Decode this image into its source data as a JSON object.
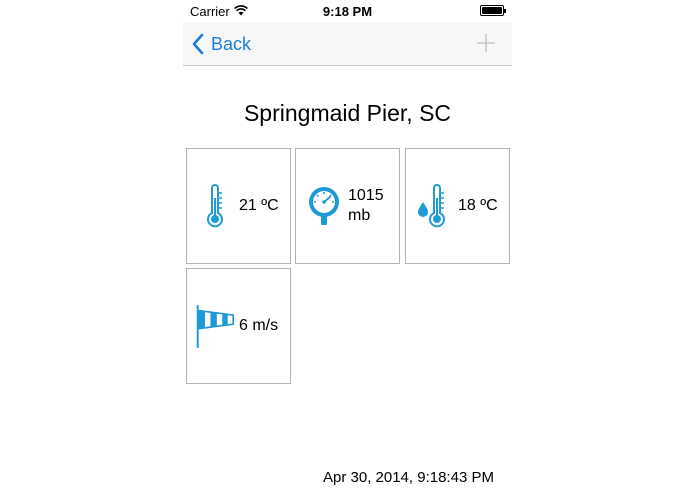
{
  "status_bar": {
    "carrier": "Carrier",
    "time": "9:18 PM"
  },
  "nav": {
    "back_label": "Back",
    "add_icon": "plus-icon"
  },
  "station": {
    "title": "Springmaid Pier, SC"
  },
  "readings": [
    {
      "icon": "thermometer-icon",
      "value": "21 ºC"
    },
    {
      "icon": "barometer-icon",
      "value": "1015 mb"
    },
    {
      "icon": "water-temperature-icon",
      "value": "18 ºC"
    },
    {
      "icon": "windsock-icon",
      "value": "6 m/s"
    }
  ],
  "updated": "Apr 30, 2014, 9:18:43 PM",
  "colors": {
    "accent": "#1b7fd9",
    "icon": "#1e9ad6",
    "tile_border": "#b3b3b3",
    "disabled": "#c7c7cc"
  }
}
